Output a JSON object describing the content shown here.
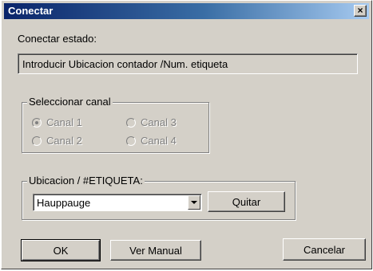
{
  "window": {
    "title": "Conectar",
    "close_glyph": "×"
  },
  "status": {
    "label": "Conectar estado:",
    "value": "Introducir Ubicacion contador /Num. etiqueta"
  },
  "channel_group": {
    "legend": "Seleccionar canal",
    "options": [
      {
        "label": "Canal 1",
        "checked": true,
        "enabled": false
      },
      {
        "label": "Canal 2",
        "checked": false,
        "enabled": false
      },
      {
        "label": "Canal 3",
        "checked": false,
        "enabled": false
      },
      {
        "label": "Canal 4",
        "checked": false,
        "enabled": false
      }
    ]
  },
  "location_group": {
    "legend": "Ubicacion / #ETIQUETA:",
    "selected": "Hauppauge",
    "remove_label": "Quitar"
  },
  "buttons": {
    "ok": "OK",
    "manual": "Ver Manual",
    "cancel": "Cancelar"
  },
  "icons": {
    "close": "close-icon",
    "dropdown": "chevron-down-icon",
    "radio": "radio-button-icon"
  },
  "colors": {
    "title_start": "#0a246a",
    "title_end": "#a6caf0",
    "face": "#d4d0c8",
    "disabled_text": "#808080"
  }
}
